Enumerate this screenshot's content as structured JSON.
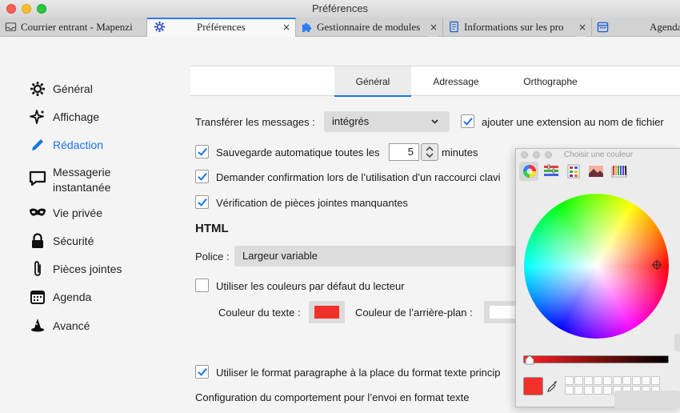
{
  "window": {
    "title": "Préférences"
  },
  "tabs": [
    {
      "label": "Courrier entrant - Mapenzi",
      "icon": "inbox-icon",
      "active": false,
      "close": ""
    },
    {
      "label": "Préférences",
      "icon": "gear-icon",
      "active": true,
      "close": "×"
    },
    {
      "label": "Gestionnaire de modules",
      "icon": "puzzle-icon",
      "active": false,
      "close": "×"
    },
    {
      "label": "Informations sur les pro",
      "icon": "document-icon",
      "active": false,
      "close": "×"
    },
    {
      "label": "Agenda",
      "icon": "calendar-icon",
      "active": false,
      "close": ""
    }
  ],
  "sidebar": {
    "items": [
      {
        "label": "Général",
        "icon": "gear-icon"
      },
      {
        "label": "Affichage",
        "icon": "sparkle-icon"
      },
      {
        "label": "Rédaction",
        "icon": "pencil-icon",
        "active": true
      },
      {
        "label": "Messagerie\ninstantanée",
        "icon": "chat-bubble-icon"
      },
      {
        "label": "Vie privée",
        "icon": "mask-icon"
      },
      {
        "label": "Sécurité",
        "icon": "lock-icon"
      },
      {
        "label": "Pièces jointes",
        "icon": "paperclip-icon"
      },
      {
        "label": "Agenda",
        "icon": "calendar-icon"
      },
      {
        "label": "Avancé",
        "icon": "wizard-hat-icon"
      }
    ]
  },
  "subtabs": [
    {
      "label": "Général",
      "active": true
    },
    {
      "label": "Adressage",
      "active": false
    },
    {
      "label": "Orthographe",
      "active": false
    }
  ],
  "general": {
    "forward_label": "Transférer les messages :",
    "forward_value": "intégrés",
    "extension_label": "ajouter une extension au nom de fichier",
    "extension_checked": true,
    "autosave_label": "Sauvegarde automatique toutes les",
    "autosave_value": "5",
    "autosave_unit": "minutes",
    "autosave_checked": true,
    "confirm_shortcut_label": "Demander confirmation lors de l’utilisation d’un raccourci clavi",
    "confirm_shortcut_checked": true,
    "attachments_check_label": "Vérification de pièces jointes manquantes",
    "attachments_check_checked": true
  },
  "html": {
    "heading": "HTML",
    "font_label": "Police :",
    "font_value": "Largeur variable",
    "default_colors_label": "Utiliser les couleurs par défaut du lecteur",
    "default_colors_checked": false,
    "text_color_label": "Couleur du texte :",
    "text_color": "#f1302a",
    "bg_color_label": "Couleur de l’arrière-plan :",
    "bg_color": "#ffffff",
    "paragraph_label": "Utiliser le format paragraphe à la place du format texte princip",
    "paragraph_checked": true,
    "send_config_label": "Configuration du comportement pour l’envoi en format texte"
  },
  "color_picker": {
    "title": "Choisir une couleur",
    "tools": [
      "color-wheel-icon",
      "color-sliders-icon",
      "color-palettes-icon",
      "image-palettes-icon",
      "crayons-icon"
    ],
    "current_color": "#f1302a"
  },
  "colors": {
    "accent": "#1b73e8",
    "red": "#f1302a"
  }
}
